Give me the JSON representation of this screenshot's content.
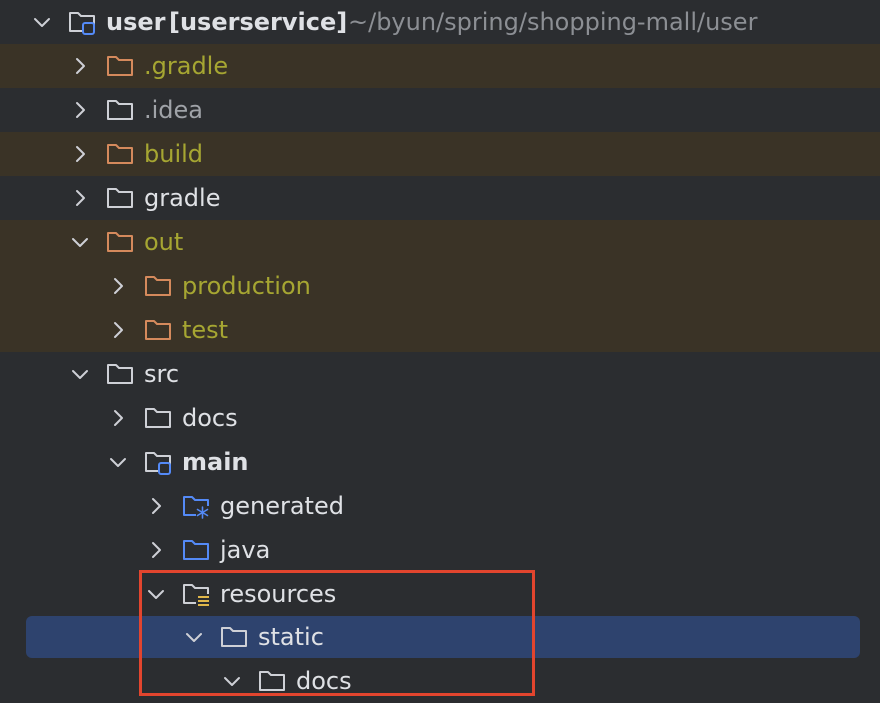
{
  "project": {
    "name": "user",
    "module": "[userservice]",
    "path": "~/byun/spring/shopping-mall/user"
  },
  "rows": [
    {
      "label": ".gradle",
      "expanded": false,
      "excluded": true
    },
    {
      "label": ".idea",
      "expanded": false,
      "excluded": false
    },
    {
      "label": "build",
      "expanded": false,
      "excluded": true
    },
    {
      "label": "gradle",
      "expanded": false,
      "excluded": false
    },
    {
      "label": "out",
      "expanded": true,
      "excluded": true
    },
    {
      "label": "production",
      "expanded": false,
      "excluded": true
    },
    {
      "label": "test",
      "expanded": false,
      "excluded": true
    },
    {
      "label": "src",
      "expanded": true,
      "excluded": false
    },
    {
      "label": "docs",
      "expanded": false,
      "excluded": false
    },
    {
      "label": "main",
      "expanded": true,
      "excluded": false,
      "type": "module"
    },
    {
      "label": "generated",
      "expanded": false,
      "excluded": false,
      "type": "generated-source"
    },
    {
      "label": "java",
      "expanded": false,
      "excluded": false,
      "type": "source"
    },
    {
      "label": "resources",
      "expanded": true,
      "excluded": false,
      "type": "resources"
    },
    {
      "label": "static",
      "expanded": true,
      "excluded": false,
      "selected": true
    },
    {
      "label": "docs",
      "expanded": true,
      "excluded": false
    }
  ],
  "colors": {
    "background": "#2b2d30",
    "excluded_row": "#3a3326",
    "excluded_text": "#a6a632",
    "selection": "#2e436e",
    "highlight_border": "#e2452e",
    "source_folder": "#548af7",
    "resources_marker": "#e0b74a"
  }
}
